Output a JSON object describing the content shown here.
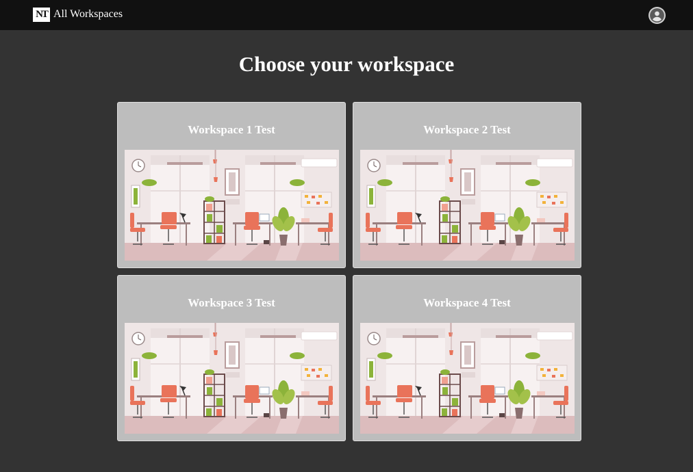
{
  "header": {
    "logo_text": "NT",
    "title": "All Workspaces",
    "avatar_icon": "account-circle-icon"
  },
  "main": {
    "title": "Choose your workspace"
  },
  "workspaces": [
    {
      "name": "Workspace 1 Test",
      "image_icon": "office-illustration"
    },
    {
      "name": "Workspace 2 Test",
      "image_icon": "office-illustration"
    },
    {
      "name": "Workspace 3 Test",
      "image_icon": "office-illustration"
    },
    {
      "name": "Workspace 4 Test",
      "image_icon": "office-illustration"
    }
  ],
  "colors": {
    "topbar": "#111111",
    "background": "#333333",
    "card": "#bdbdbd",
    "accent": "#e9735a"
  }
}
